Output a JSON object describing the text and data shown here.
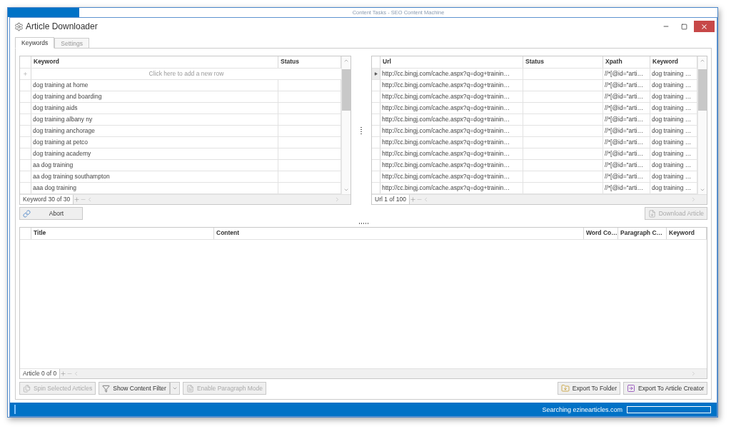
{
  "background_window": {
    "title": "Content Tasks - SEO Content Machine"
  },
  "window": {
    "title": "Article Downloader"
  },
  "tabs": [
    {
      "label": "Keywords",
      "selected": true
    },
    {
      "label": "Settings",
      "selected": false
    }
  ],
  "keyword_grid": {
    "columns": [
      "Keyword",
      "Status"
    ],
    "new_row_prompt": "Click here to add a new row",
    "rows": [
      "dog training at home",
      "dog training and boarding",
      "dog training aids",
      "dog training albany ny",
      "dog training anchorage",
      "dog training at petco",
      "dog training academy",
      "aa dog training",
      "aa dog training southampton",
      "aaa dog training"
    ],
    "navigator": "Keyword 30 of 30"
  },
  "url_grid": {
    "columns": [
      "Url",
      "Status",
      "Xpath",
      "Keyword"
    ],
    "rows": [
      {
        "url": "http://cc.bingj.com/cache.aspx?q=dog+trainin…",
        "xpath": "//*[@id=\"arti…",
        "keyword": "dog training …",
        "selected": true
      },
      {
        "url": "http://cc.bingj.com/cache.aspx?q=dog+trainin…",
        "xpath": "//*[@id=\"arti…",
        "keyword": "dog training …",
        "selected": false
      },
      {
        "url": "http://cc.bingj.com/cache.aspx?q=dog+trainin…",
        "xpath": "//*[@id=\"arti…",
        "keyword": "dog training …",
        "selected": false
      },
      {
        "url": "http://cc.bingj.com/cache.aspx?q=dog+trainin…",
        "xpath": "//*[@id=\"arti…",
        "keyword": "dog training …",
        "selected": false
      },
      {
        "url": "http://cc.bingj.com/cache.aspx?q=dog+trainin…",
        "xpath": "//*[@id=\"arti…",
        "keyword": "dog training …",
        "selected": false
      },
      {
        "url": "http://cc.bingj.com/cache.aspx?q=dog+trainin…",
        "xpath": "//*[@id=\"arti…",
        "keyword": "dog training …",
        "selected": false
      },
      {
        "url": "http://cc.bingj.com/cache.aspx?q=dog+trainin…",
        "xpath": "//*[@id=\"arti…",
        "keyword": "dog training …",
        "selected": false
      },
      {
        "url": "http://cc.bingj.com/cache.aspx?q=dog+trainin…",
        "xpath": "//*[@id=\"arti…",
        "keyword": "dog training …",
        "selected": false
      },
      {
        "url": "http://cc.bingj.com/cache.aspx?q=dog+trainin…",
        "xpath": "//*[@id=\"arti…",
        "keyword": "dog training …",
        "selected": false
      },
      {
        "url": "http://cc.bingj.com/cache.aspx?q=dog+trainin…",
        "xpath": "//*[@id=\"arti…",
        "keyword": "dog training …",
        "selected": false
      },
      {
        "url": "http://cc.bingj.com/cache.aspx?q=dog+trainin…",
        "xpath": "//*[@id=\"arti…",
        "keyword": "dog training …",
        "selected": false
      }
    ],
    "navigator": "Url 1 of 100"
  },
  "abort_button": {
    "label": "Abort",
    "disabled": false
  },
  "download_button": {
    "label": "Download Article",
    "disabled": true
  },
  "article_grid": {
    "columns": [
      "Title",
      "Content",
      "Word Co…",
      "Paragraph C…",
      "Keyword"
    ],
    "navigator": "Article 0 of 0"
  },
  "left_toolbar": [
    {
      "kind": "spin",
      "label": "Spin Selected Articles",
      "disabled": true
    },
    {
      "kind": "filter",
      "label": "Show Content Filter",
      "disabled": false
    },
    {
      "kind": "paragraph",
      "label": "Enable Paragraph Mode",
      "disabled": true
    }
  ],
  "right_toolbar": [
    {
      "kind": "folder",
      "label": "Export To Folder",
      "disabled": false
    },
    {
      "kind": "export",
      "label": "Export To Article Creator",
      "disabled": false
    }
  ],
  "status_bar": {
    "text": "Searching ezinearticles.com",
    "level": 0
  }
}
